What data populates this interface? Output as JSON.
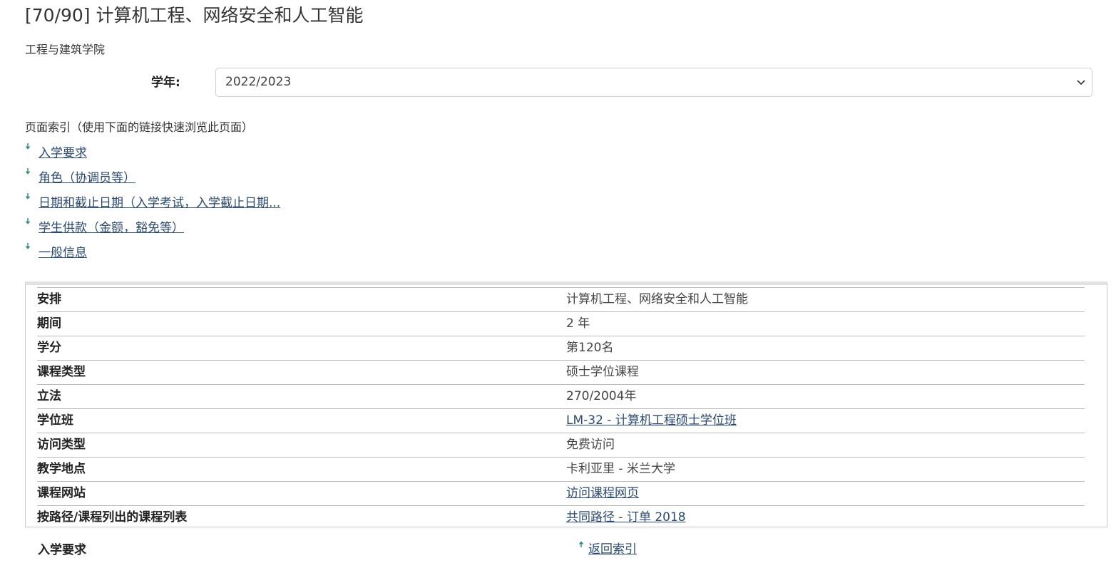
{
  "page": {
    "title": "[70/90] 计算机工程、网络安全和人工智能",
    "school": "工程与建筑学院"
  },
  "year": {
    "label": "学年:",
    "selected": "2022/2023"
  },
  "index": {
    "heading": "页面索引（使用下面的链接快速浏览此页面）",
    "items": [
      {
        "label": "入学要求"
      },
      {
        "label": "角色（协调员等）"
      },
      {
        "label": "日期和截止日期（入学考试，入学截止日期..."
      },
      {
        "label": "学生供款（金额，豁免等）"
      },
      {
        "label": "一般信息"
      }
    ]
  },
  "info": {
    "rows": [
      {
        "key": "安排",
        "value": "计算机工程、网络安全和人工智能"
      },
      {
        "key": "期间",
        "value": "2 年"
      },
      {
        "key": "学分",
        "value": "第120名"
      },
      {
        "key": "课程类型",
        "value": "硕士学位课程"
      },
      {
        "key": "立法",
        "value": "270/2004年"
      },
      {
        "key": "学位班",
        "value": "LM-32 - 计算机工程硕士学位班"
      },
      {
        "key": "访问类型",
        "value": "免费访问"
      },
      {
        "key": "教学地点",
        "value": "卡利亚里 - 米兰大学"
      },
      {
        "key": "课程网站",
        "value": "访问课程网页"
      },
      {
        "key": "按路径/课程列出的课程列表",
        "value": "共同路径 - 订单 2018"
      }
    ]
  },
  "section": {
    "title": "入学要求",
    "back_label": "返回索引"
  },
  "colors": {
    "link": "#2b4a72",
    "arrow": "#2e8b7a",
    "text": "#333333",
    "border": "#b9b9b9"
  },
  "icons": {
    "select": "chevron-down-icon",
    "index_arrow": "arrow-down-icon",
    "back_arrow": "arrow-up-icon"
  }
}
